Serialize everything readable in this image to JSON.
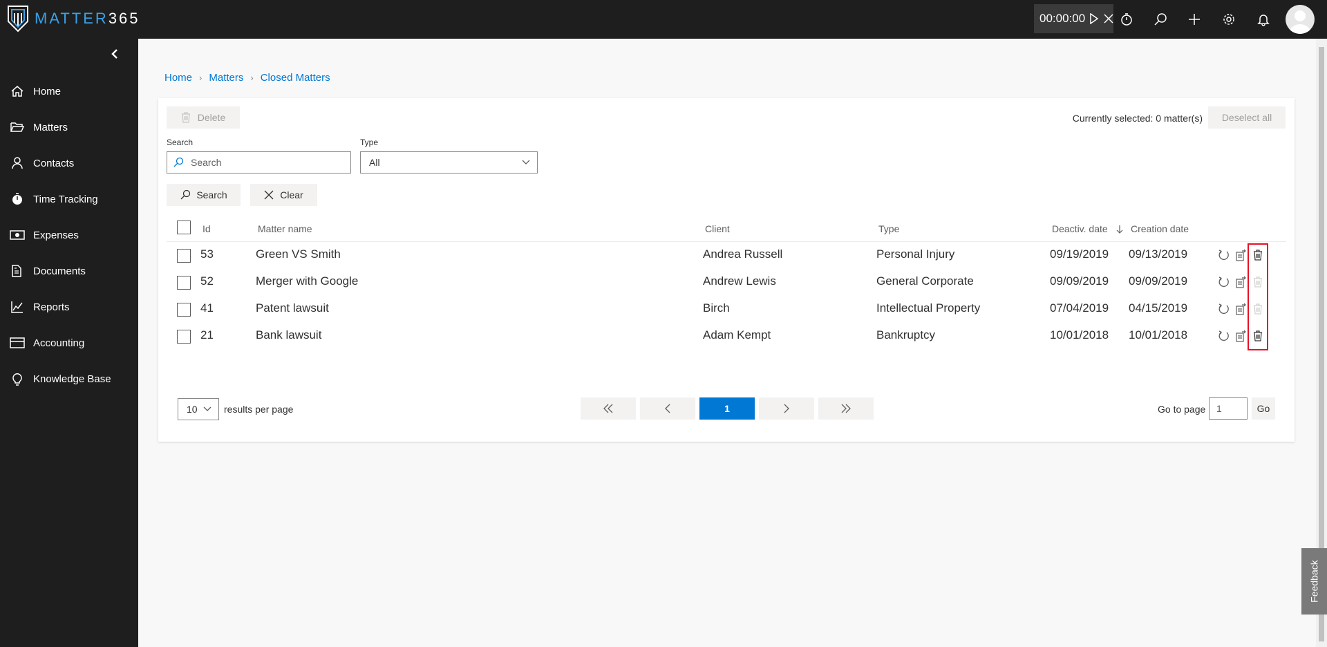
{
  "app": {
    "logo_word": "MATTER",
    "logo_num": "365"
  },
  "topbar": {
    "timer": "00:00:00"
  },
  "sidebar": {
    "items": [
      {
        "label": "Home",
        "icon": "home-icon"
      },
      {
        "label": "Matters",
        "icon": "folder-open-icon"
      },
      {
        "label": "Contacts",
        "icon": "person-icon"
      },
      {
        "label": "Time Tracking",
        "icon": "stopwatch-icon"
      },
      {
        "label": "Expenses",
        "icon": "money-icon"
      },
      {
        "label": "Documents",
        "icon": "documents-icon"
      },
      {
        "label": "Reports",
        "icon": "chart-line-icon"
      },
      {
        "label": "Accounting",
        "icon": "card-icon"
      },
      {
        "label": "Knowledge Base",
        "icon": "lightbulb-icon"
      }
    ]
  },
  "breadcrumb": [
    "Home",
    "Matters",
    "Closed Matters"
  ],
  "toolbar": {
    "delete_label": "Delete",
    "selected_text": "Currently selected: 0 matter(s)",
    "deselect_label": "Deselect all"
  },
  "filters": {
    "search_label": "Search",
    "search_placeholder": "Search",
    "type_label": "Type",
    "type_value": "All",
    "search_button": "Search",
    "clear_button": "Clear"
  },
  "table": {
    "headers": [
      "Id",
      "Matter name",
      "Client",
      "Type",
      "Deactiv. date",
      "Creation date"
    ],
    "rows": [
      {
        "id": "53",
        "name": "Green VS Smith",
        "client": "Andrea Russell",
        "type": "Personal Injury",
        "deactiv": "09/19/2019",
        "created": "09/13/2019",
        "delete_enabled": true
      },
      {
        "id": "52",
        "name": "Merger with Google",
        "client": "Andrew Lewis",
        "type": "General Corporate",
        "deactiv": "09/09/2019",
        "created": "09/09/2019",
        "delete_enabled": false
      },
      {
        "id": "41",
        "name": "Patent lawsuit",
        "client": "Birch",
        "type": "Intellectual Property",
        "deactiv": "07/04/2019",
        "created": "04/15/2019",
        "delete_enabled": false
      },
      {
        "id": "21",
        "name": "Bank lawsuit",
        "client": "Adam Kempt",
        "type": "Bankruptcy",
        "deactiv": "10/01/2018",
        "created": "10/01/2018",
        "delete_enabled": true
      }
    ]
  },
  "pagination": {
    "per_page": "10",
    "per_page_label": "results per page",
    "current_page": "1",
    "goto_label": "Go to page",
    "goto_value": "1",
    "go_button": "Go"
  },
  "feedback_label": "Feedback",
  "colors": {
    "accent": "#0078d4",
    "sidebar": "#1e1e1e",
    "highlight": "#e81123"
  }
}
